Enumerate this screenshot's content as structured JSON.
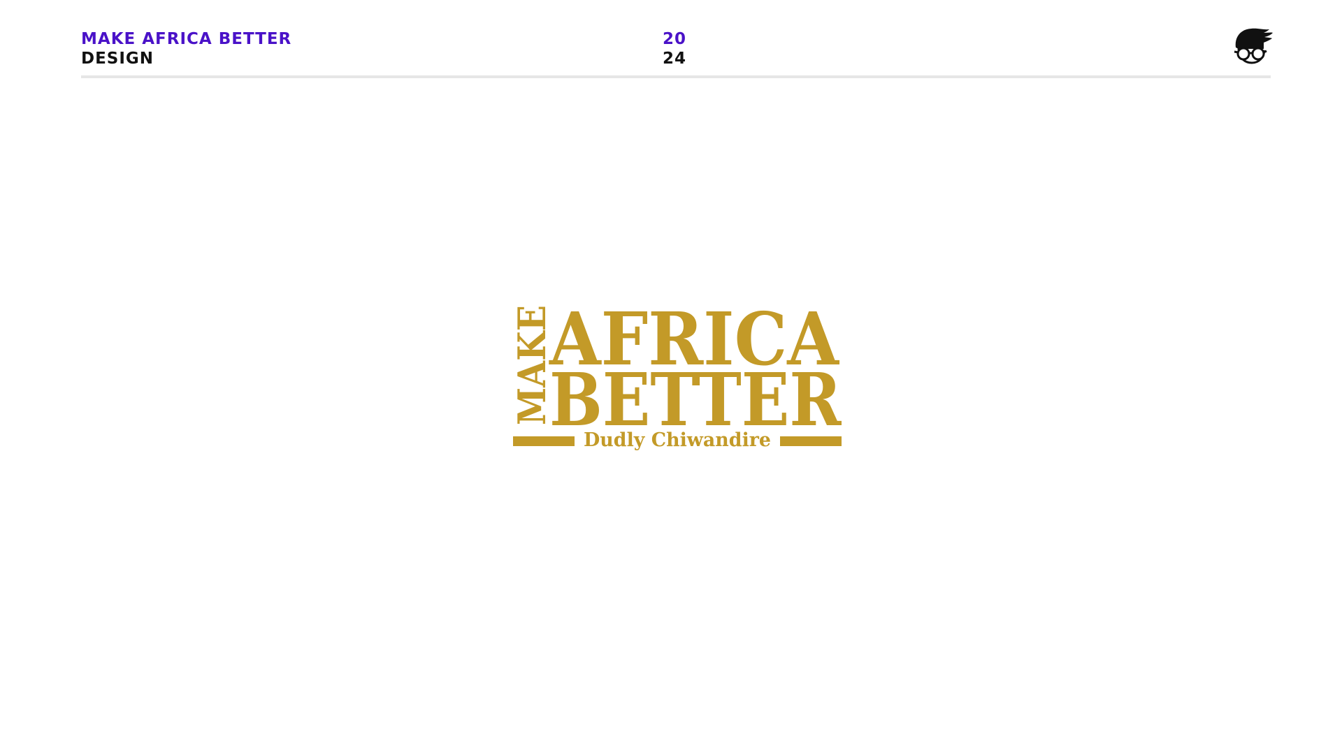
{
  "header": {
    "project_title": "MAKE AFRICA BETTER",
    "project_subtitle": "DESIGN",
    "year_top": "20",
    "year_bottom": "24",
    "brand_icon": "avatar-glasses-icon"
  },
  "logo": {
    "vertical_word": "MAKE",
    "line1": "AFRICA",
    "line2": "BETTER",
    "author": "Dudly Chiwandire"
  },
  "colors": {
    "accent": "#4a12c8",
    "text_dark": "#111111",
    "logo_gold": "#c39a28",
    "divider": "#e6e6e6"
  }
}
